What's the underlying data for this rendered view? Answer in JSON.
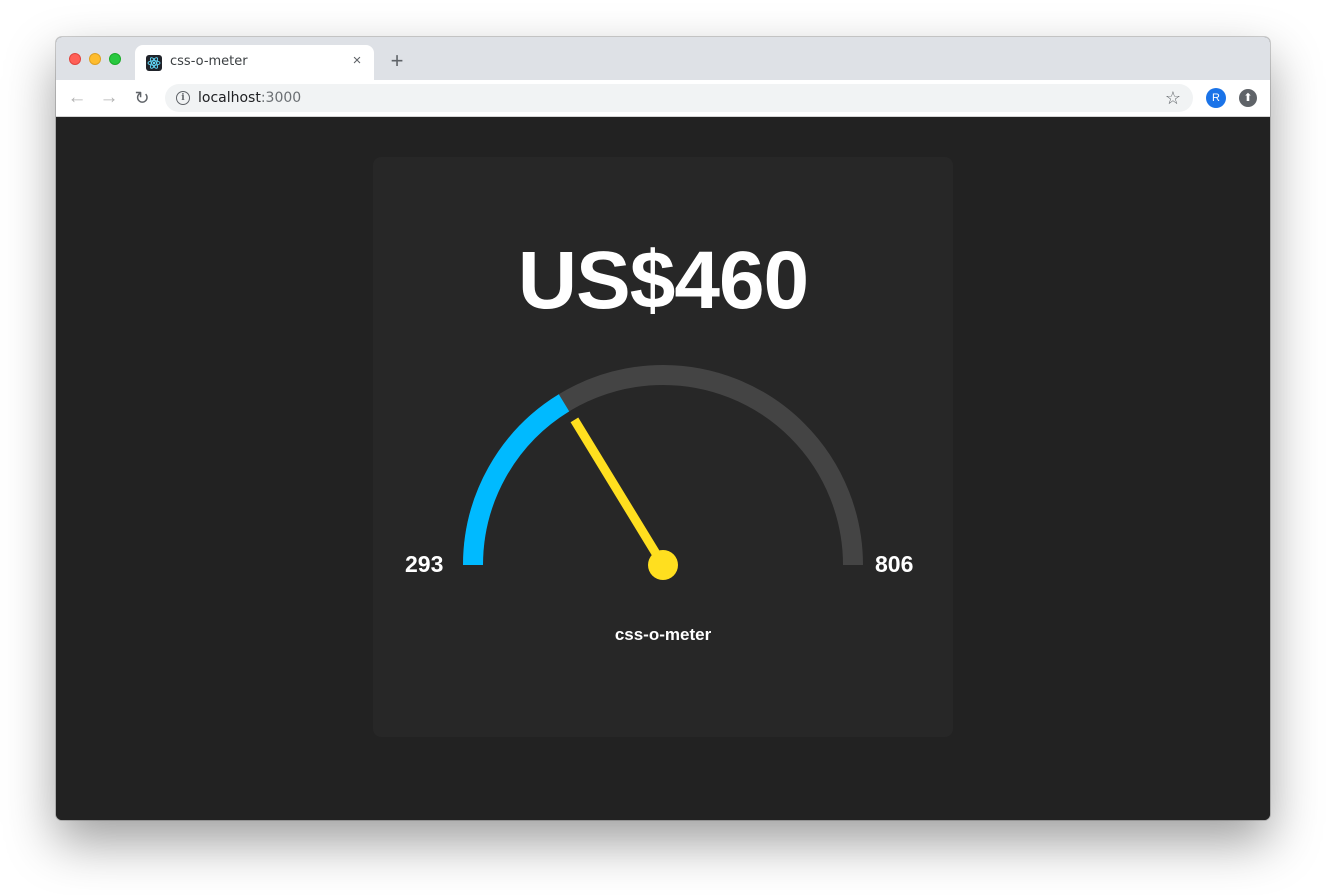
{
  "browser": {
    "tab_title": "css-o-meter",
    "tab_close": "×",
    "new_tab": "+",
    "url_host": "localhost",
    "url_port": ":3000",
    "avatar_initial": "R",
    "back_glyph": "←",
    "forward_glyph": "→",
    "reload_glyph": "↻",
    "star_glyph": "☆",
    "info_glyph": "i",
    "ext_glyph": "⬆"
  },
  "meter": {
    "display_value": "US$460",
    "min_label": "293",
    "max_label": "806",
    "caption": "css-o-meter",
    "min": 293,
    "max": 806,
    "value": 460
  },
  "colors": {
    "track": "#444444",
    "fill": "#00baff",
    "needle": "#ffdf1f",
    "card_bg": "#272727",
    "page_bg": "#222222"
  }
}
